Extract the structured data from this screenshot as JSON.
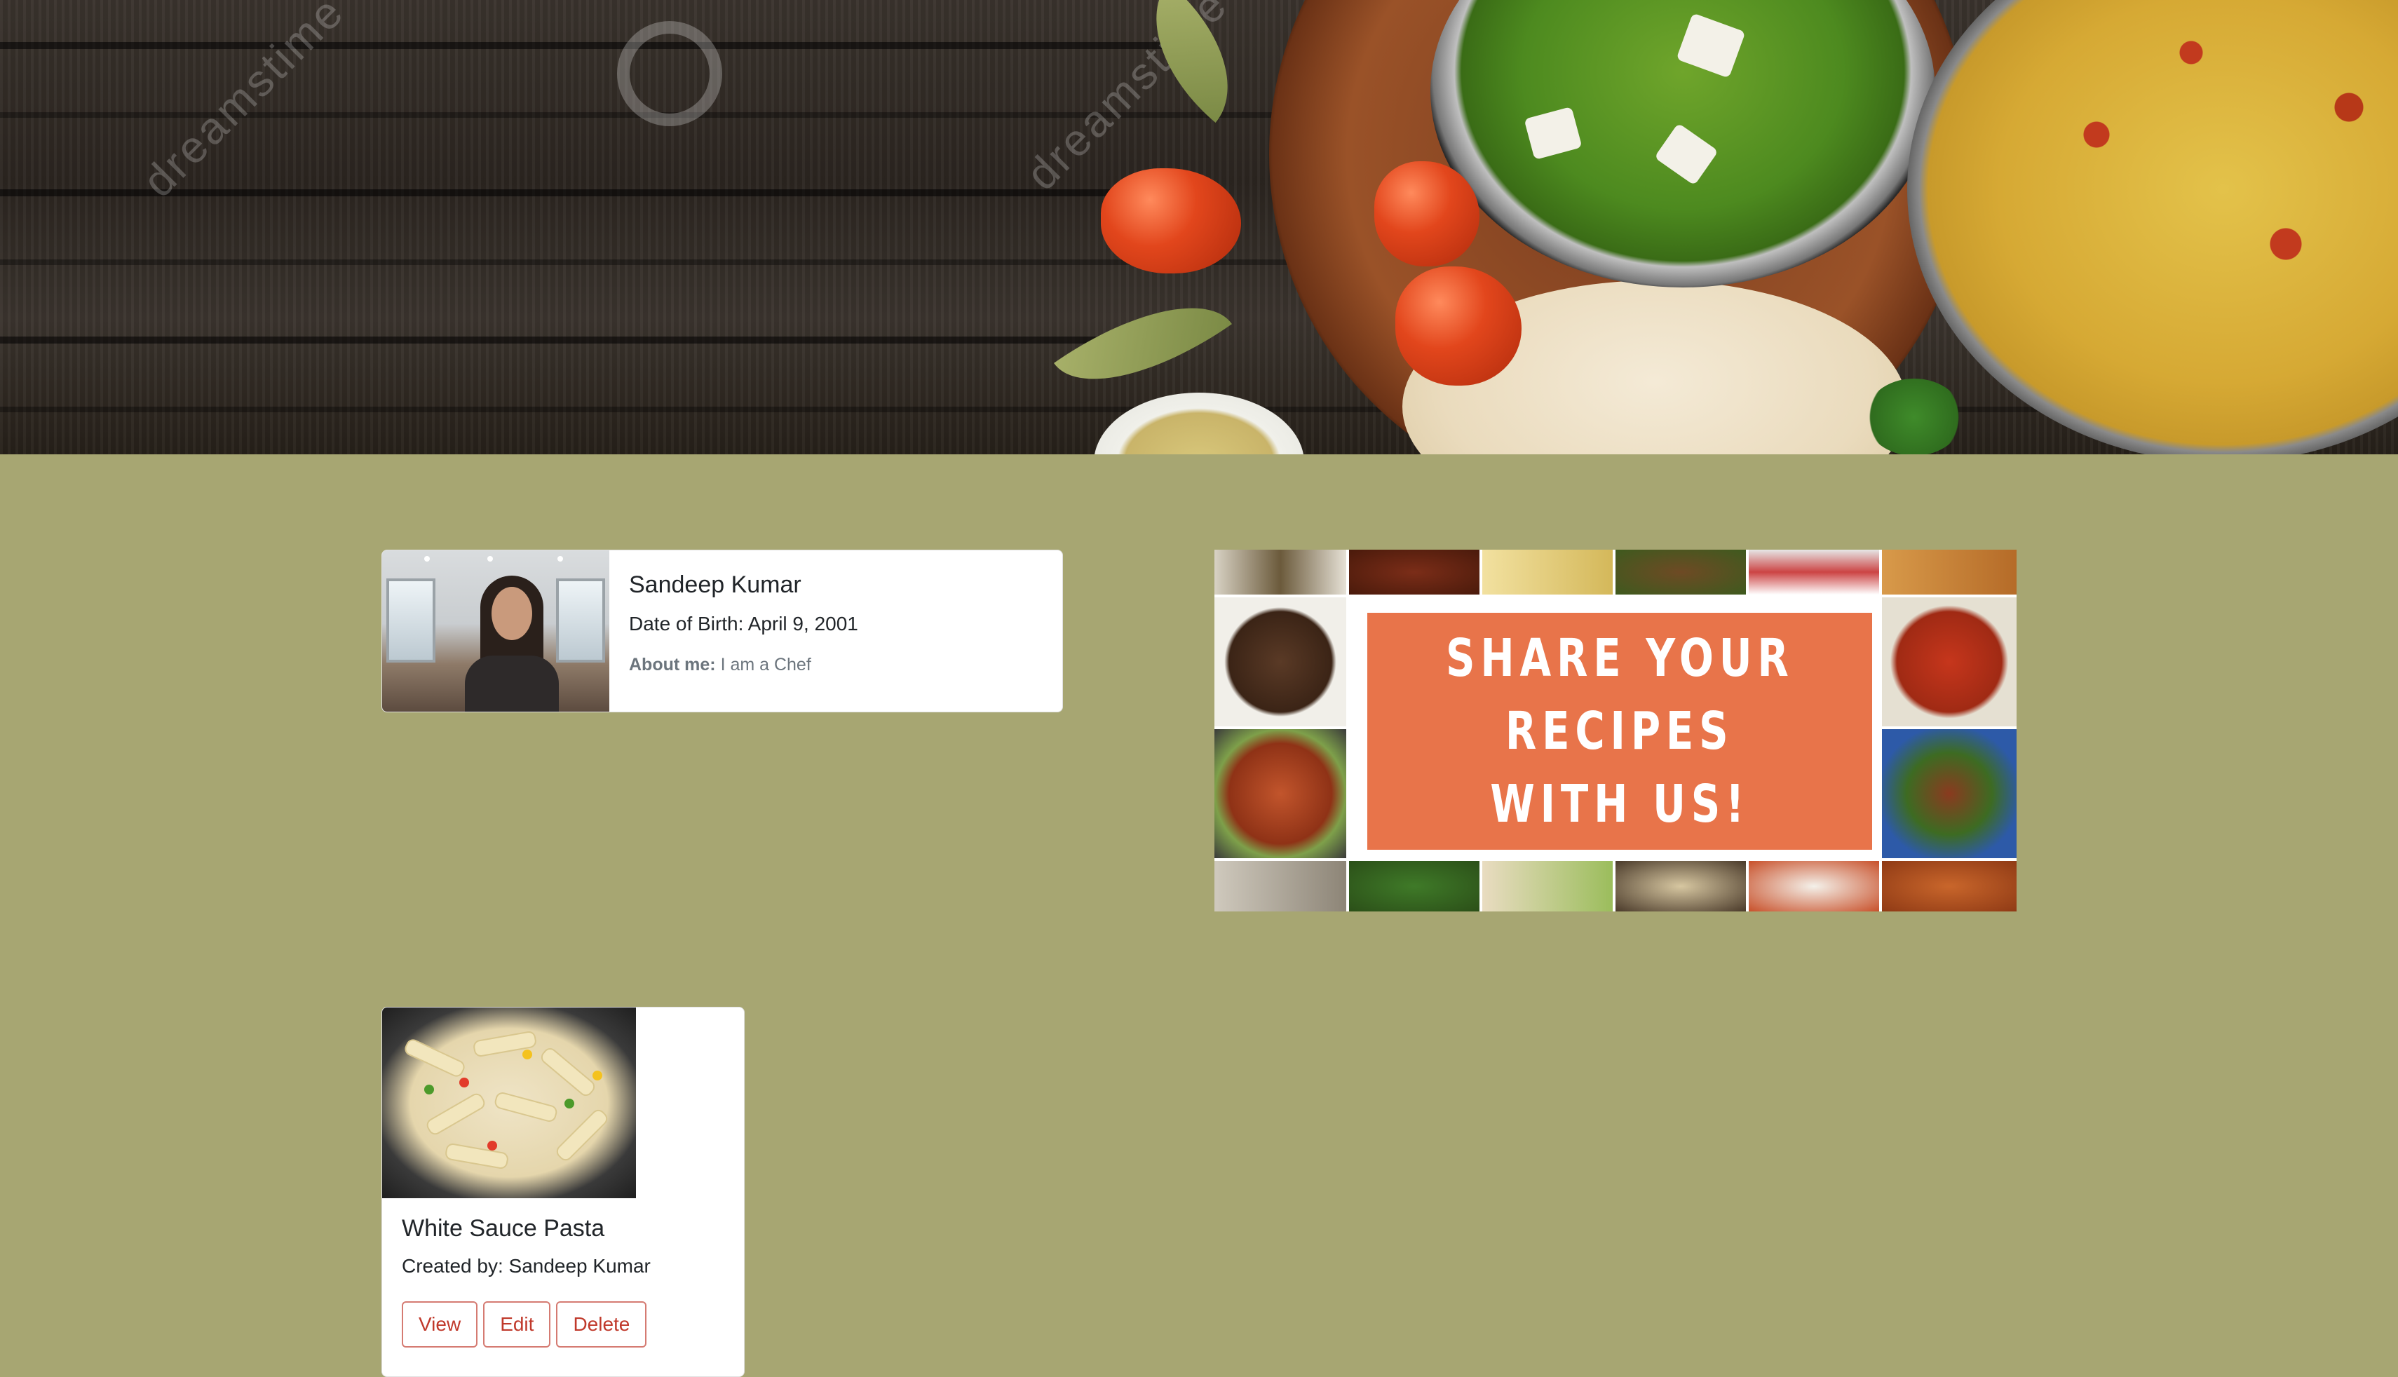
{
  "hero": {
    "description_icon": "food-banner-image"
  },
  "profile": {
    "name": "Sandeep Kumar",
    "dob": "Date of Birth: April 9, 2001",
    "about_label": "About me:",
    "about_text": "I am a Chef"
  },
  "promo": {
    "line1": "SHARE YOUR",
    "line2": "RECIPES",
    "line3": "WITH US!"
  },
  "recipes": [
    {
      "title": "White Sauce Pasta",
      "author": "Created by: Sandeep Kumar",
      "actions": {
        "view": "View",
        "edit": "Edit",
        "delete": "Delete"
      }
    }
  ],
  "colors": {
    "page_bg": "#a7a672",
    "card_bg": "#ffffff",
    "promo_orange": "#e8744a",
    "danger": "#c0392b"
  }
}
